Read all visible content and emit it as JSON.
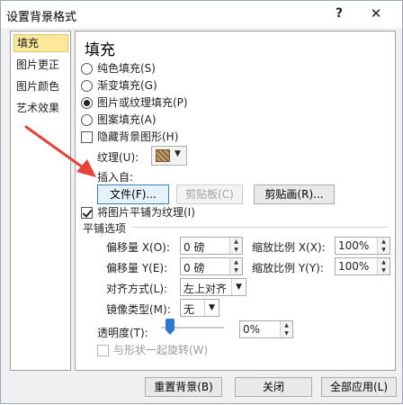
{
  "window": {
    "title": "设置背景格式",
    "help_label": "?",
    "close_label": "✕"
  },
  "sidebar": {
    "items": [
      {
        "label": "填充",
        "selected": true
      },
      {
        "label": "图片更正",
        "selected": false
      },
      {
        "label": "图片颜色",
        "selected": false
      },
      {
        "label": "艺术效果",
        "selected": false
      }
    ]
  },
  "fill": {
    "heading": "填充",
    "options": [
      {
        "label": "纯色填充(S)",
        "selected": false
      },
      {
        "label": "渐变填充(G)",
        "selected": false
      },
      {
        "label": "图片或纹理填充(P)",
        "selected": true
      },
      {
        "label": "图案填充(A)",
        "selected": false
      }
    ],
    "hide_bg_graphics": {
      "label": "隐藏背景图形(H)",
      "checked": false
    },
    "texture_label": "纹理(U):",
    "texture_icon": "texture-swatch-icon",
    "insert_from_label": "插入自:",
    "file_button": "文件(F)...",
    "clipboard_button": "剪贴板(C)",
    "clipart_button": "剪贴画(R)...",
    "tile_checkbox": {
      "label": "将图片平铺为纹理(I)",
      "checked": true
    }
  },
  "tiling": {
    "heading": "平铺选项",
    "offset_x_label": "偏移量 X(O):",
    "offset_x_value": "0 磅",
    "offset_y_label": "偏移量 Y(E):",
    "offset_y_value": "0 磅",
    "scale_x_label": "缩放比例 X(X):",
    "scale_x_value": "100%",
    "scale_y_label": "缩放比例 Y(Y):",
    "scale_y_value": "100%",
    "alignment_label": "对齐方式(L):",
    "alignment_value": "左上对齐",
    "mirror_label": "镜像类型(M):",
    "mirror_value": "无"
  },
  "transparency": {
    "label": "透明度(T):",
    "value": "0%",
    "level_percent": 0
  },
  "rotate_with_shape": {
    "label": "与形状一起旋转(W)",
    "checked": false,
    "disabled": true
  },
  "footer": {
    "reset_button": "重置背景(B)",
    "close_button": "关闭",
    "apply_all_button": "全部应用(L)"
  },
  "colors": {
    "annotation_arrow": "#e8413a",
    "selected_item_bg": "#fde79a",
    "slider_thumb": "#2a7ad2"
  }
}
